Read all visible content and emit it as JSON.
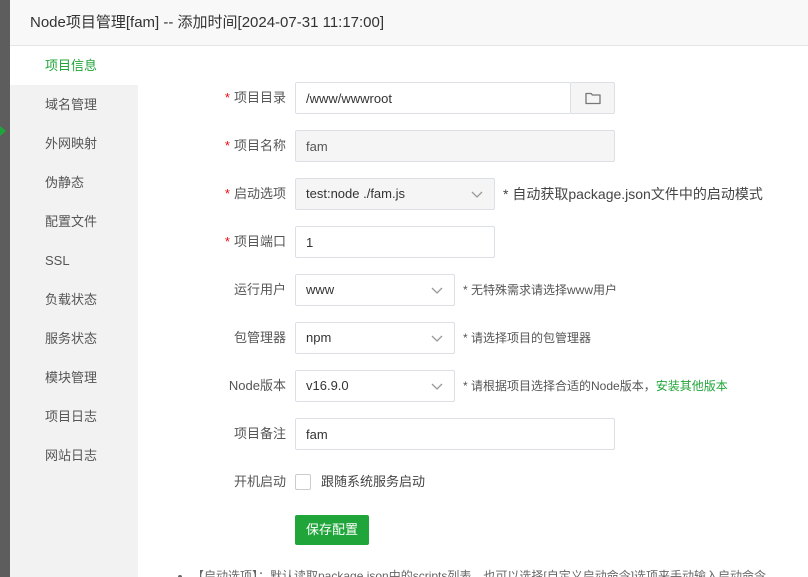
{
  "dialog": {
    "title": "Node项目管理[fam] -- 添加时间[2024-07-31 11:17:00]"
  },
  "sidebar": {
    "items": [
      {
        "label": "项目信息",
        "active": true
      },
      {
        "label": "域名管理"
      },
      {
        "label": "外网映射"
      },
      {
        "label": "伪静态"
      },
      {
        "label": "配置文件"
      },
      {
        "label": "SSL"
      },
      {
        "label": "负载状态"
      },
      {
        "label": "服务状态"
      },
      {
        "label": "模块管理"
      },
      {
        "label": "项目日志"
      },
      {
        "label": "网站日志"
      }
    ]
  },
  "form": {
    "required_mark": "*",
    "project_dir": {
      "label": "项目目录",
      "value": "/www/wwwroot",
      "button_icon": "folder-icon"
    },
    "project_name": {
      "label": "项目名称",
      "value": "fam"
    },
    "start_option": {
      "label": "启动选项",
      "value": "test:node ./fam.js",
      "hint": "* 自动获取package.json文件中的启动模式"
    },
    "project_port": {
      "label": "项目端口",
      "value": "1"
    },
    "run_user": {
      "label": "运行用户",
      "value": "www",
      "hint": "* 无特殊需求请选择www用户"
    },
    "package_manager": {
      "label": "包管理器",
      "value": "npm",
      "hint": "* 请选择项目的包管理器"
    },
    "node_version": {
      "label": "Node版本",
      "value": "v16.9.0",
      "hint": "* 请根据项目选择合适的Node版本，",
      "hint_link": "安装其他版本"
    },
    "project_remark": {
      "label": "项目备注",
      "value": "fam"
    },
    "autostart": {
      "label": "开机启动",
      "checkbox_label": "跟随系统服务启动",
      "checked": false
    },
    "save_label": "保存配置"
  },
  "note": {
    "text": "【启动选项】：默认读取package.json中的scripts列表，也可以选择[自定义启动命令]选项来手动输入启动命令"
  },
  "colors": {
    "accent": "#20a53a",
    "required": "#ef0808"
  }
}
